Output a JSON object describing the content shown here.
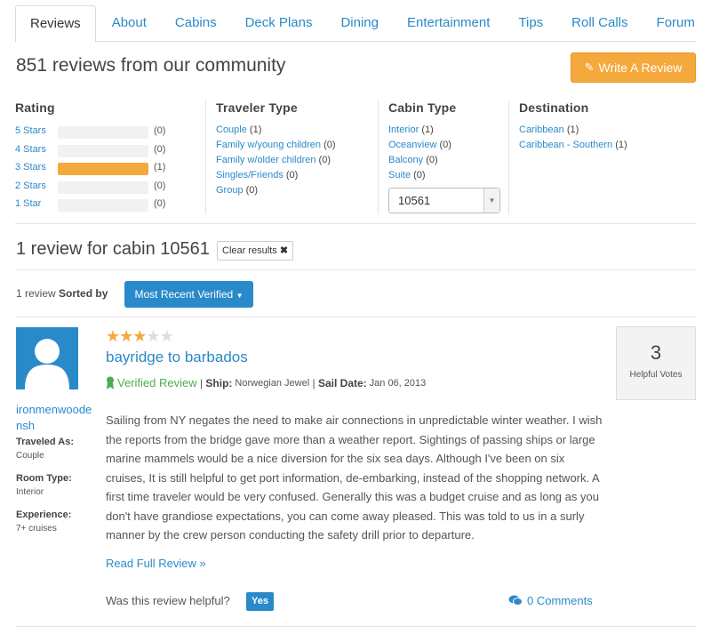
{
  "tabs": [
    "Reviews",
    "About",
    "Cabins",
    "Deck Plans",
    "Dining",
    "Entertainment",
    "Tips",
    "Roll Calls",
    "Forum"
  ],
  "headline": "851 reviews from our community",
  "write_review": "Write A Review",
  "filters": {
    "rating": {
      "title": "Rating",
      "rows": [
        {
          "label": "5 Stars",
          "count": "(0)",
          "fill": 0
        },
        {
          "label": "4 Stars",
          "count": "(0)",
          "fill": 0
        },
        {
          "label": "3 Stars",
          "count": "(1)",
          "fill": 1
        },
        {
          "label": "2 Stars",
          "count": "(0)",
          "fill": 0
        },
        {
          "label": "1 Star",
          "count": "(0)",
          "fill": 0
        }
      ]
    },
    "traveler": {
      "title": "Traveler Type",
      "items": [
        {
          "label": "Couple",
          "count": "(1)"
        },
        {
          "label": "Family w/young children",
          "count": "(0)"
        },
        {
          "label": "Family w/older children",
          "count": "(0)"
        },
        {
          "label": "Singles/Friends",
          "count": "(0)"
        },
        {
          "label": "Group",
          "count": "(0)"
        }
      ]
    },
    "cabin": {
      "title": "Cabin Type",
      "items": [
        {
          "label": "Interior",
          "count": "(1)"
        },
        {
          "label": "Oceanview",
          "count": "(0)"
        },
        {
          "label": "Balcony",
          "count": "(0)"
        },
        {
          "label": "Suite",
          "count": "(0)"
        }
      ],
      "selected": "10561"
    },
    "destination": {
      "title": "Destination",
      "items": [
        {
          "label": "Caribbean",
          "count": "(1)"
        },
        {
          "label": "Caribbean - Southern",
          "count": "(1)"
        }
      ]
    }
  },
  "cabin_heading": "1 review for cabin 10561",
  "clear_results": "Clear results",
  "sort": {
    "count_text": "1 review",
    "sorted_by": "Sorted by",
    "button": "Most Recent Verified"
  },
  "review": {
    "username": "ironmenwoodensh",
    "traveled_as_label": "Traveled As:",
    "traveled_as": "Couple",
    "room_type_label": "Room Type:",
    "room_type": "Interior",
    "experience_label": "Experience:",
    "experience": "7+ cruises",
    "rating": 3,
    "rating_max": 5,
    "title": "bayridge to barbados",
    "verified": "Verified Review",
    "ship_label": "Ship:",
    "ship": "Norwegian Jewel",
    "sail_label": "Sail Date:",
    "sail_date": "Jan 06, 2013",
    "body": "Sailing from NY negates the need to make air connections in unpredictable winter weather. I wish the reports from the bridge gave more than a weather report. Sightings of passing ships or large marine mammels would be a nice diversion for the six sea days. Although I've been on six cruises, It is still helpful to get port information, de-embarking, instead of the shopping network. A first time traveler would be very confused. Generally this was a budget cruise and as long as you don't have grandiose expectations, you can come away pleased. This was told to us in a surly manner by the crew person conducting the safety drill prior to departure.",
    "read_more": "Read Full Review »",
    "helpful_q": "Was this review helpful?",
    "yes": "Yes",
    "comments": "0 Comments",
    "helpful_votes": "3",
    "helpful_votes_label": "Helpful Votes"
  },
  "colors": {
    "link": "#2a8ac9",
    "accent": "#f5a83b",
    "verified": "#4cae4c"
  }
}
